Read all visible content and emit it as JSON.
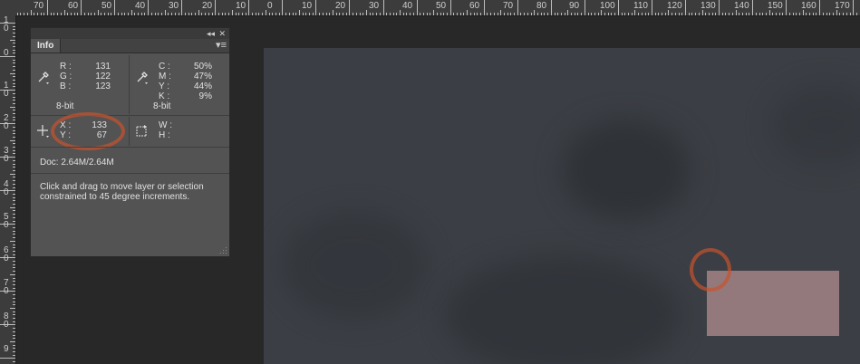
{
  "ruler_top": [
    "70",
    "60",
    "50",
    "40",
    "30",
    "20",
    "10",
    "0",
    "10",
    "20",
    "30",
    "40",
    "50",
    "60",
    "70",
    "80",
    "90",
    "100",
    "110",
    "120",
    "130",
    "140",
    "150",
    "160",
    "170"
  ],
  "ruler_left": [
    "1",
    "0",
    "0",
    "1",
    "0",
    "2",
    "0",
    "3",
    "0",
    "4",
    "0",
    "5",
    "0",
    "6",
    "0",
    "7",
    "0",
    "8",
    "0",
    "9"
  ],
  "panel": {
    "tab": "Info",
    "collapse_icon": "◂◂",
    "close_icon": "✕",
    "menu_icon": "▾≡",
    "rgb": {
      "labels": [
        "R :",
        "G :",
        "B :"
      ],
      "values": [
        "131",
        "122",
        "123"
      ],
      "bit": "8-bit"
    },
    "cmyk": {
      "labels": [
        "C :",
        "M :",
        "Y :",
        "K :"
      ],
      "values": [
        "50%",
        "47%",
        "44%",
        "9%"
      ],
      "bit": "8-bit"
    },
    "xy": {
      "labels": [
        "X :",
        "Y :"
      ],
      "values": [
        "133",
        "67"
      ]
    },
    "wh": {
      "labels": [
        "W :",
        "H :"
      ]
    },
    "doc": "Doc: 2.64M/2.64M",
    "tip": "Click and drag to move layer or selection constrained to 45 degree increments."
  },
  "colors": {
    "selection": "#9b7e80",
    "annotation": "#c8532e",
    "canvas": "#3b3e44"
  }
}
